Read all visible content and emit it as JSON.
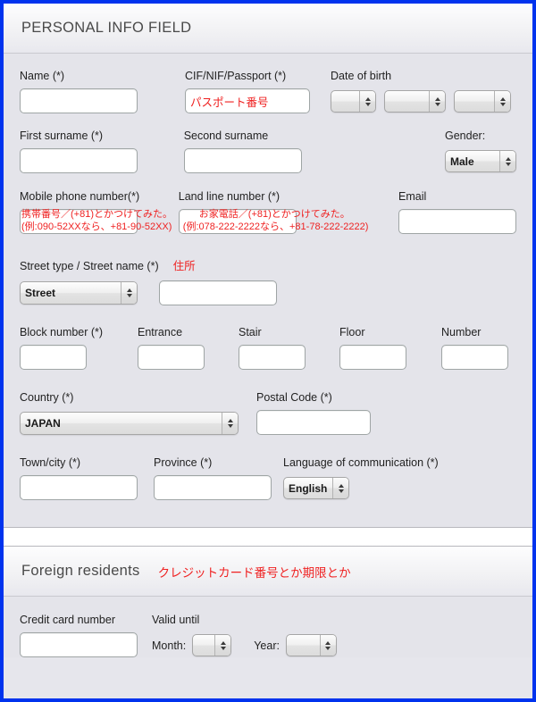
{
  "sections": [
    {
      "id": "personal",
      "title": "PERSONAL INFO FIELD",
      "note": ""
    },
    {
      "id": "foreign",
      "title": "Foreign residents",
      "note": "クレジットカード番号とか期限とか"
    }
  ],
  "personal": {
    "name": {
      "label": "Name (*)",
      "value": "",
      "placeholder": ""
    },
    "passport": {
      "label": "CIF/NIF/Passport (*)",
      "value": "パスポート番号",
      "placeholder": ""
    },
    "date_of_birth": {
      "label": "Date of birth",
      "day": {
        "value": ""
      },
      "month": {
        "value": ""
      },
      "year": {
        "value": ""
      }
    },
    "first_surname": {
      "label": "First surname (*)",
      "value": ""
    },
    "second_surname": {
      "label": "Second surname",
      "value": ""
    },
    "gender": {
      "label": "Gender:",
      "value": "Male"
    },
    "mobile_phone": {
      "label": "Mobile phone number(*)",
      "value": "",
      "annotation_line1": "携帯番号／(+81)とかつけてみた。",
      "annotation_line2": "(例:090-52XXなら、+81-90-52XX)"
    },
    "land_line": {
      "label": "Land line number (*)",
      "value": "",
      "annotation_line1": "お家電話／(+81)とかつけてみた。",
      "annotation_line2": "(例:078-222-2222なら、+81-78-222-2222)"
    },
    "email": {
      "label": "Email",
      "value": ""
    },
    "street": {
      "label": "Street type / Street name (*)",
      "annotation": "住所",
      "type_value": "Street",
      "name_value": ""
    },
    "block_number": {
      "label": "Block number (*)",
      "value": ""
    },
    "entrance": {
      "label": "Entrance",
      "value": ""
    },
    "stair": {
      "label": "Stair",
      "value": ""
    },
    "floor": {
      "label": "Floor",
      "value": ""
    },
    "number": {
      "label": "Number",
      "value": ""
    },
    "country": {
      "label": "Country (*)",
      "value": "JAPAN"
    },
    "postal_code": {
      "label": "Postal Code (*)",
      "value": ""
    },
    "town_city": {
      "label": "Town/city (*)",
      "value": ""
    },
    "province": {
      "label": "Province (*)",
      "value": ""
    },
    "language": {
      "label": "Language of communication (*)",
      "value": "English"
    }
  },
  "foreign": {
    "credit_card": {
      "label": "Credit card number",
      "value": ""
    },
    "valid_until": {
      "label": "Valid until"
    },
    "month": {
      "label": "Month:",
      "value": ""
    },
    "year": {
      "label": "Year:",
      "value": ""
    }
  },
  "colors": {
    "page_border": "#0033ee",
    "background": "#e4e4ea",
    "annotation_red": "#ef2222",
    "label_text": "#222222",
    "title_text": "#4a4a4a"
  }
}
